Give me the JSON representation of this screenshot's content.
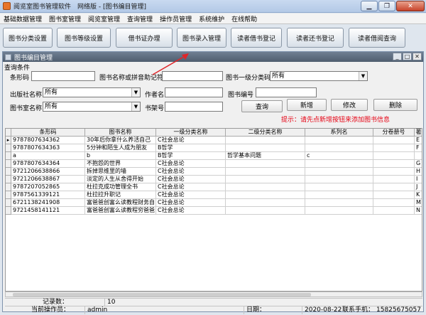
{
  "window": {
    "title": "阅览室图书管理软件　网络版 - [图书编目管理]"
  },
  "menu": [
    "基础数据管理",
    "图书室管理",
    "阅览室管理",
    "查询管理",
    "操作员管理",
    "系统维护",
    "在线帮助"
  ],
  "toolbar": [
    "图书分类设置",
    "图书等级设置",
    "借书证办理",
    "图书录入管理",
    "读者借书登记",
    "读者还书登记",
    "读者借阅查询"
  ],
  "child": {
    "title": "图书编目管理",
    "query_label": "查询条件",
    "labels": {
      "barcode": "条形码",
      "name_py": "图书名称或拼音助记符",
      "cat1": "图书一级分类码",
      "publisher": "出版社名称",
      "author": "作者名",
      "book_no": "图书编号",
      "room": "图书室名称",
      "shelf": "书架号"
    },
    "values": {
      "barcode": "",
      "name_py": "",
      "cat1": "所有",
      "publisher": "所有",
      "author": "",
      "book_no": "",
      "room": "所有",
      "shelf": ""
    },
    "buttons": {
      "query": "查询",
      "add": "新增",
      "modify": "修改",
      "delete": "删除"
    },
    "tip": "提示：请先点新增按钮来添加图书信息"
  },
  "grid": {
    "columns": [
      "条形码",
      "图书名称",
      "一级分类名称",
      "二级分类名称",
      "系列名",
      "分卷册号",
      "著"
    ],
    "rows": [
      [
        "9787807634362",
        "30年后你拿什么养活自己",
        "C社会总论",
        "",
        "",
        "",
        "E"
      ],
      [
        "9787807634363",
        "5分钟和陌生人成为朋友",
        "B哲学",
        "",
        "",
        "",
        "F"
      ],
      [
        "a",
        "b",
        "B哲学",
        "哲学基本问题",
        "c",
        "",
        ""
      ],
      [
        "9787807634364",
        "不抱怨的世界",
        "C社会总论",
        "",
        "",
        "",
        "G"
      ],
      [
        "9721206638866",
        "拆掉思维里的墙",
        "C社会总论",
        "",
        "",
        "",
        "H"
      ],
      [
        "9721206638867",
        "淡定的人生从舍得开始",
        "C社会总论",
        "",
        "",
        "",
        "I"
      ],
      [
        "9787207052865",
        "杜拉克成功管理全书",
        "C社会总论",
        "",
        "",
        "",
        "J"
      ],
      [
        "9787561339121",
        "杜拉拉升职记",
        "C社会总论",
        "",
        "",
        "",
        "K"
      ],
      [
        "6721138241908",
        "富爸爸创富么读教程财务自",
        "C社会总论",
        "",
        "",
        "",
        "M"
      ],
      [
        "9721458141121",
        "富爸爸创富么读教程穷爸爸",
        "C社会总论",
        "",
        "",
        "",
        "N"
      ]
    ]
  },
  "status": {
    "count_label": "记录数：",
    "count": "10",
    "operator_label": "当前操作员：",
    "operator": "admin",
    "date_label": "日期：",
    "date": "2020-08-22",
    "phone_label": "联系手机：",
    "phone": "15825675057"
  },
  "colors": {
    "tip": "#e60012",
    "annotation_arrow": "#e0262a"
  }
}
